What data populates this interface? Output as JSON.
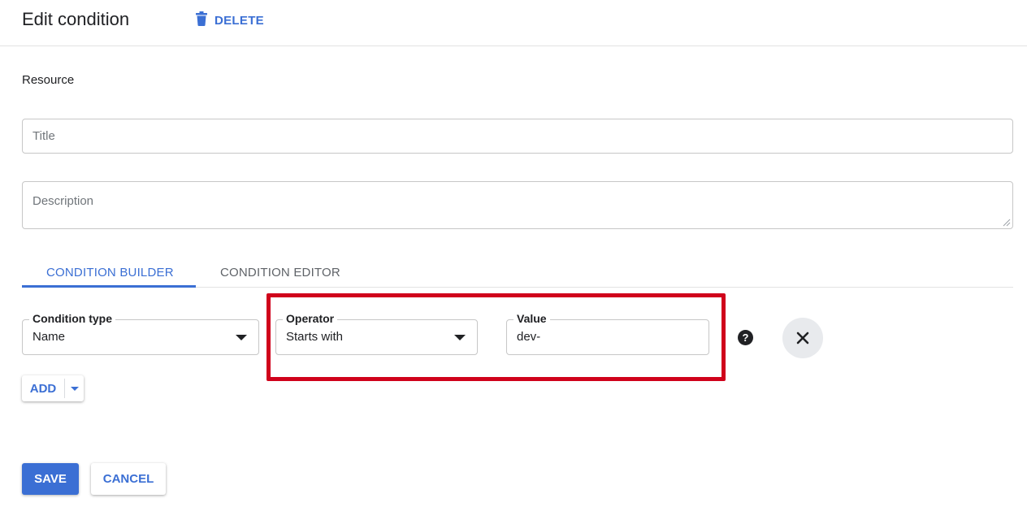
{
  "header": {
    "title": "Edit condition",
    "delete_label": "DELETE"
  },
  "form": {
    "section_label": "Resource",
    "title_placeholder": "Title",
    "description_placeholder": "Description"
  },
  "tabs": [
    {
      "label": "CONDITION BUILDER",
      "active": true
    },
    {
      "label": "CONDITION EDITOR",
      "active": false
    }
  ],
  "condition_row": {
    "condition_type": {
      "label": "Condition type",
      "value": "Name"
    },
    "operator": {
      "label": "Operator",
      "value": "Starts with"
    },
    "value_field": {
      "label": "Value",
      "value": "dev-"
    },
    "help_glyph": "?"
  },
  "add_button": {
    "label": "ADD"
  },
  "actions": {
    "save_label": "SAVE",
    "cancel_label": "CANCEL"
  },
  "icons": {
    "delete": "trash-icon",
    "help": "help-circle-icon",
    "remove": "close-icon",
    "dropdown": "caret-down-icon"
  },
  "colors": {
    "accent": "#3b6fd4",
    "highlight": "#d0021b",
    "border": "#c7c7c7"
  }
}
